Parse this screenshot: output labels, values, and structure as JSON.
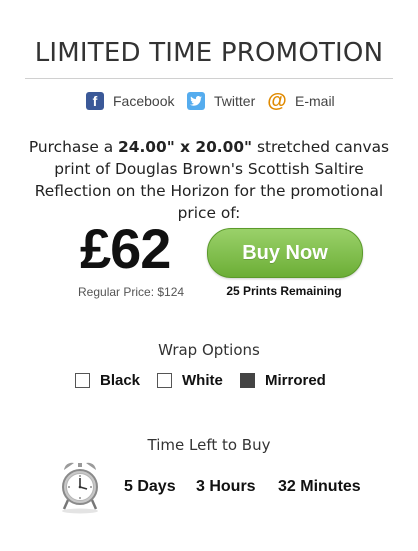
{
  "header": {
    "title": "LIMITED TIME PROMOTION"
  },
  "share": [
    {
      "label": "Facebook",
      "icon": "facebook-icon"
    },
    {
      "label": "Twitter",
      "icon": "twitter-icon"
    },
    {
      "label": "E-mail",
      "icon": "email-icon"
    }
  ],
  "description": {
    "prefix": "Purchase a ",
    "size": "24.00\" x 20.00\"",
    "suffix": " stretched canvas print of Douglas Brown's Scottish Saltire Reflection on the Horizon for the promotional price of:"
  },
  "offer": {
    "price": "£62",
    "regular_price": "Regular Price: $124",
    "buy_label": "Buy Now",
    "remaining": "25 Prints Remaining"
  },
  "wrap": {
    "title": "Wrap Options",
    "options": [
      {
        "label": "Black",
        "selected": false
      },
      {
        "label": "White",
        "selected": false
      },
      {
        "label": "Mirrored",
        "selected": true
      }
    ]
  },
  "timer": {
    "title": "Time Left to Buy",
    "days": "5 Days",
    "hours": "3 Hours",
    "minutes": "32 Minutes",
    "icon": "alarm-clock-icon"
  }
}
